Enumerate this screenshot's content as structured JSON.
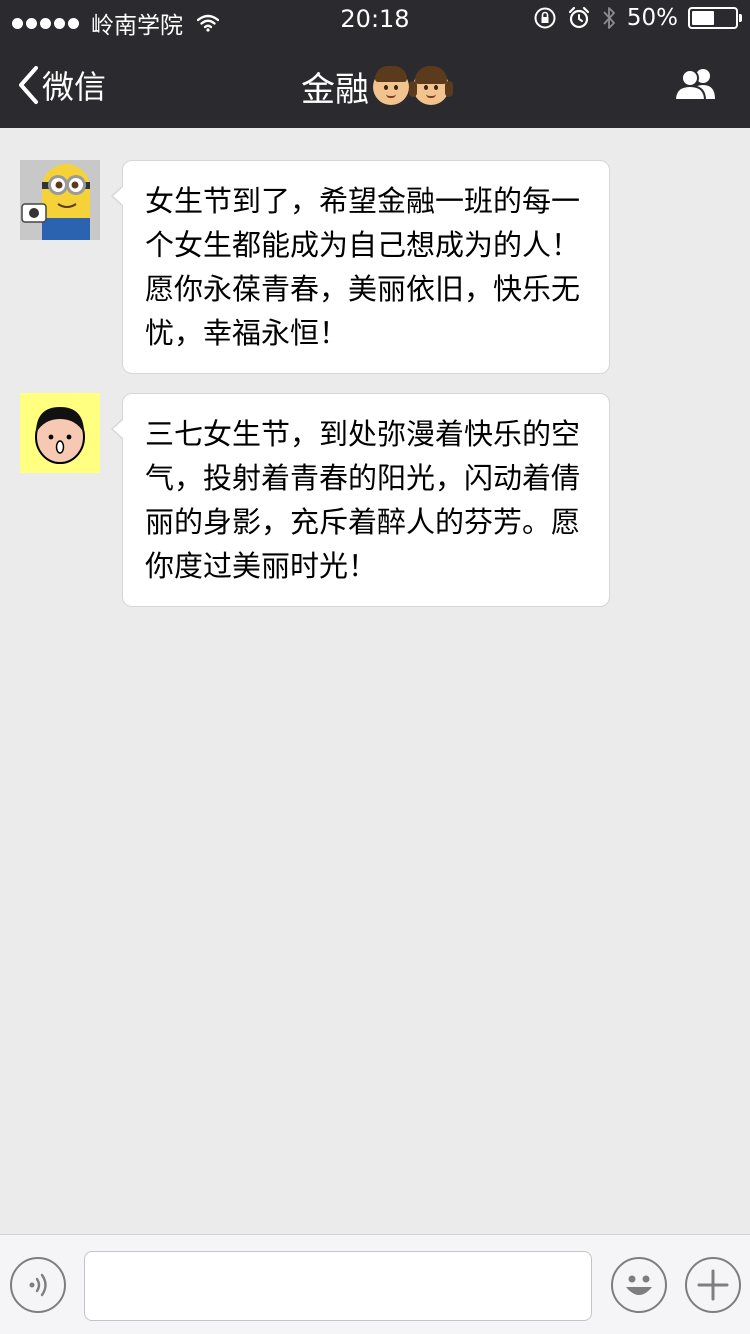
{
  "status_bar": {
    "carrier": "岭南学院",
    "time": "20:18",
    "battery": "50%",
    "battery_level": 0.5
  },
  "nav": {
    "back_label": "微信",
    "title": "金融"
  },
  "messages": [
    {
      "avatar": "minion-avatar",
      "text": "女生节到了，希望金融一班的每一个女生都能成为自己想成为的人！愿你永葆青春，美丽依旧，快乐无忧，幸福永恒！"
    },
    {
      "avatar": "cartoon-face-avatar",
      "text": "三七女生节，到处弥漫着快乐的空气，投射着青春的阳光，闪动着倩丽的身影，充斥着醉人的芬芳。愿你度过美丽时光！"
    }
  ],
  "input_bar": {
    "placeholder": "",
    "icons": [
      "voice-icon",
      "emoji-icon",
      "plus-icon"
    ]
  },
  "colors": {
    "nav_bg": "#2b2b2f",
    "chat_bg": "#ebebeb",
    "bubble_bg": "#ffffff",
    "input_bg": "#f5f5f7"
  }
}
